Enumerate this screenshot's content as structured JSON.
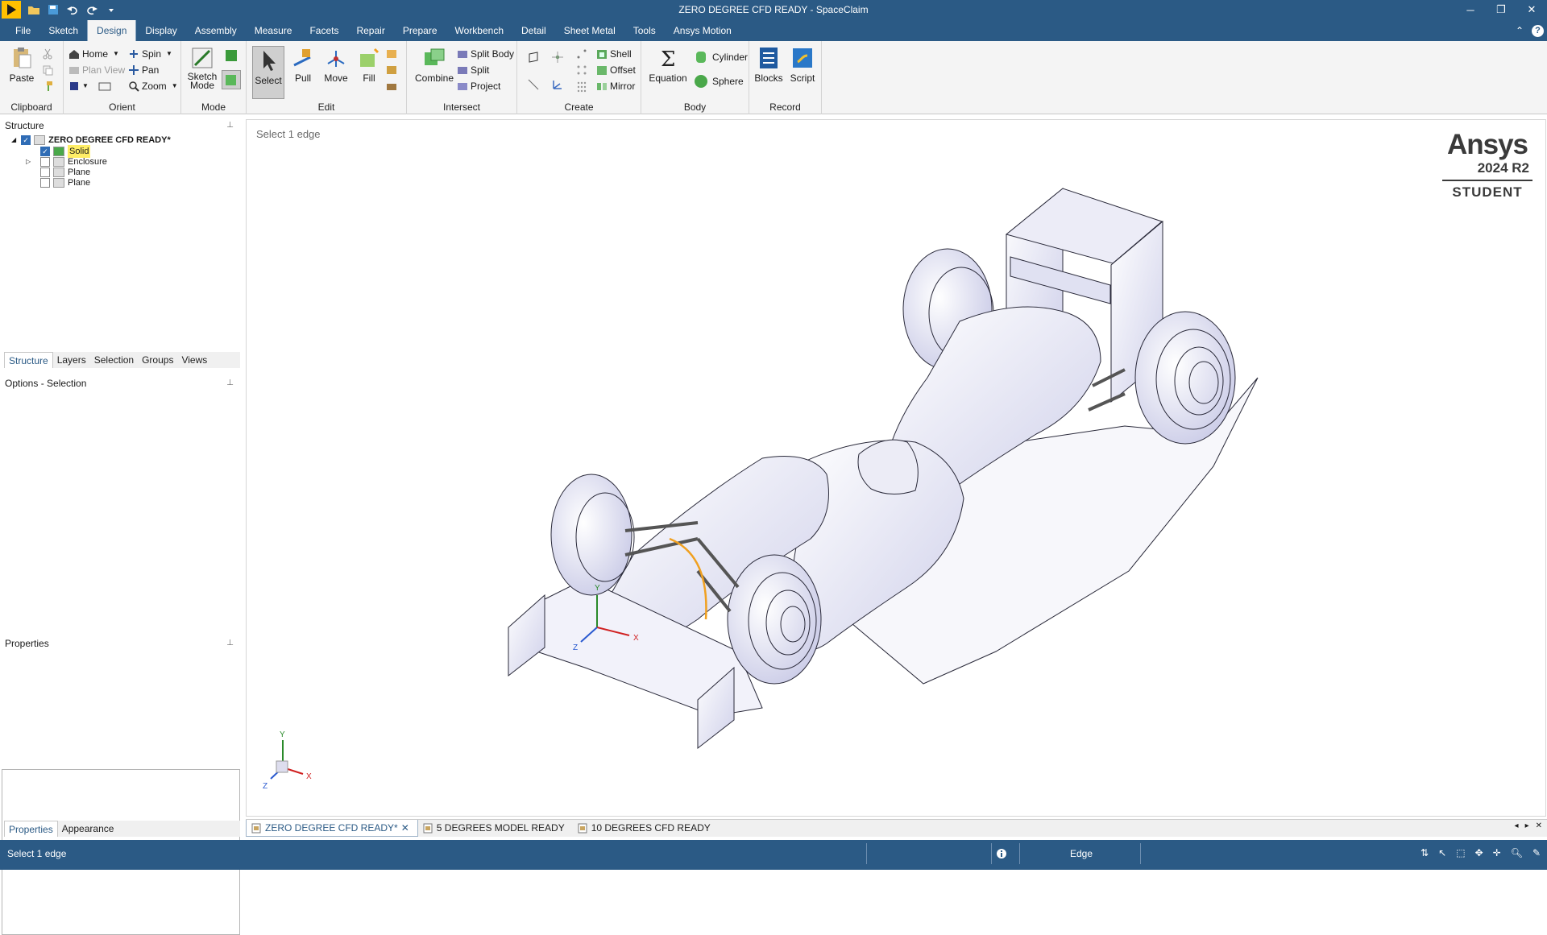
{
  "window": {
    "title": "ZERO DEGREE CFD READY - SpaceClaim"
  },
  "menu": {
    "tabs": [
      "File",
      "Sketch",
      "Design",
      "Display",
      "Assembly",
      "Measure",
      "Facets",
      "Repair",
      "Prepare",
      "Workbench",
      "Detail",
      "Sheet Metal",
      "Tools",
      "Ansys Motion"
    ],
    "active": "Design"
  },
  "ribbon": {
    "clipboard": {
      "label": "Clipboard",
      "paste": "Paste"
    },
    "orient": {
      "label": "Orient",
      "home": "Home",
      "plan_view": "Plan View",
      "spin": "Spin",
      "pan": "Pan",
      "zoom": "Zoom"
    },
    "mode": {
      "label": "Mode",
      "sketch_mode": "Sketch Mode"
    },
    "edit": {
      "label": "Edit",
      "select": "Select",
      "pull": "Pull",
      "move": "Move",
      "fill": "Fill"
    },
    "intersect": {
      "label": "Intersect",
      "combine": "Combine",
      "split_body": "Split Body",
      "split": "Split",
      "project": "Project"
    },
    "create": {
      "label": "Create",
      "shell": "Shell",
      "offset": "Offset",
      "mirror": "Mirror"
    },
    "body": {
      "label": "Body",
      "equation": "Equation",
      "cylinder": "Cylinder",
      "sphere": "Sphere"
    },
    "record": {
      "label": "Record",
      "blocks": "Blocks",
      "script": "Script"
    }
  },
  "structure": {
    "title": "Structure",
    "items": [
      {
        "label": "ZERO DEGREE CFD READY*",
        "checked": true
      },
      {
        "label": "Solid",
        "checked": true,
        "highlighted": true
      },
      {
        "label": "Enclosure",
        "checked": false
      },
      {
        "label": "Plane",
        "checked": false
      },
      {
        "label": "Plane",
        "checked": false
      }
    ],
    "tabs": [
      "Structure",
      "Layers",
      "Selection",
      "Groups",
      "Views"
    ],
    "active_tab": "Structure"
  },
  "options": {
    "title": "Options - Selection"
  },
  "properties": {
    "title": "Properties",
    "tabs": [
      "Properties",
      "Appearance"
    ],
    "active_tab": "Properties"
  },
  "viewport": {
    "prompt": "Select 1 edge",
    "logo": {
      "brand": "Ansys",
      "version": "2024 R2",
      "edition": "STUDENT"
    },
    "triad_labels": {
      "x": "X",
      "y": "Y",
      "z": "Z"
    }
  },
  "documents": [
    {
      "label": "ZERO DEGREE CFD READY*",
      "active": true,
      "closable": true
    },
    {
      "label": "5 DEGREES MODEL READY",
      "active": false
    },
    {
      "label": "10 DEGREES CFD READY",
      "active": false
    }
  ],
  "status": {
    "message": "Select 1 edge",
    "mode": "Edge"
  },
  "colors": {
    "chrome": "#2b5a85",
    "ribbon": "#f4f4f4",
    "selection_edge": "#f0a020",
    "model_shade": "#e8e8f6"
  }
}
